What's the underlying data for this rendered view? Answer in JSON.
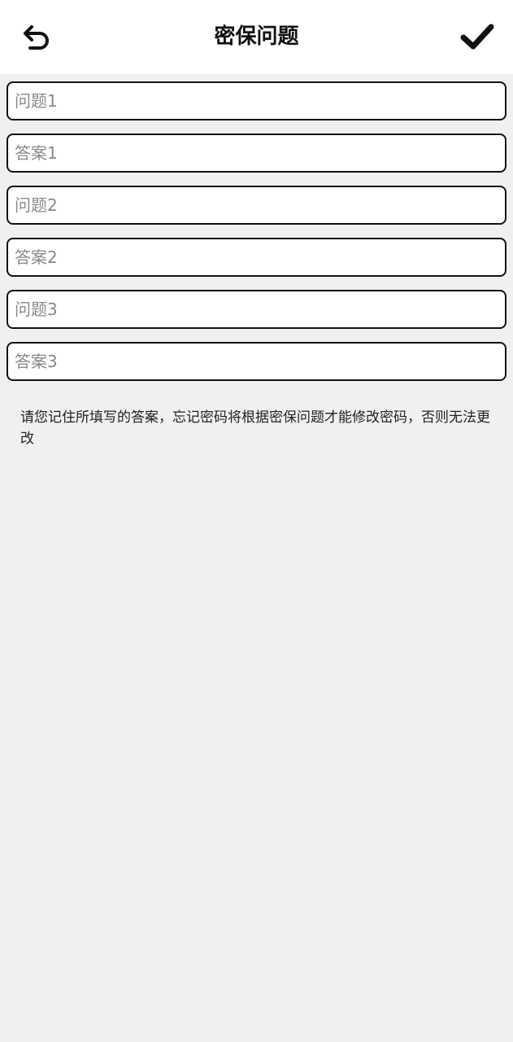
{
  "header": {
    "title": "密保问题",
    "back_icon": "undo-arrow-icon",
    "confirm_icon": "checkmark-icon"
  },
  "form": {
    "fields": [
      {
        "placeholder": "问题1",
        "value": ""
      },
      {
        "placeholder": "答案1",
        "value": ""
      },
      {
        "placeholder": "问题2",
        "value": ""
      },
      {
        "placeholder": "答案2",
        "value": ""
      },
      {
        "placeholder": "问题3",
        "value": ""
      },
      {
        "placeholder": "答案3",
        "value": ""
      }
    ]
  },
  "notice": {
    "text": "请您记住所填写的答案，忘记密码将根据密保问题才能修改密码，否则无法更改"
  },
  "colors": {
    "background": "#f0f0f0",
    "header_background": "#ffffff",
    "border": "#111111",
    "placeholder": "#888888"
  }
}
